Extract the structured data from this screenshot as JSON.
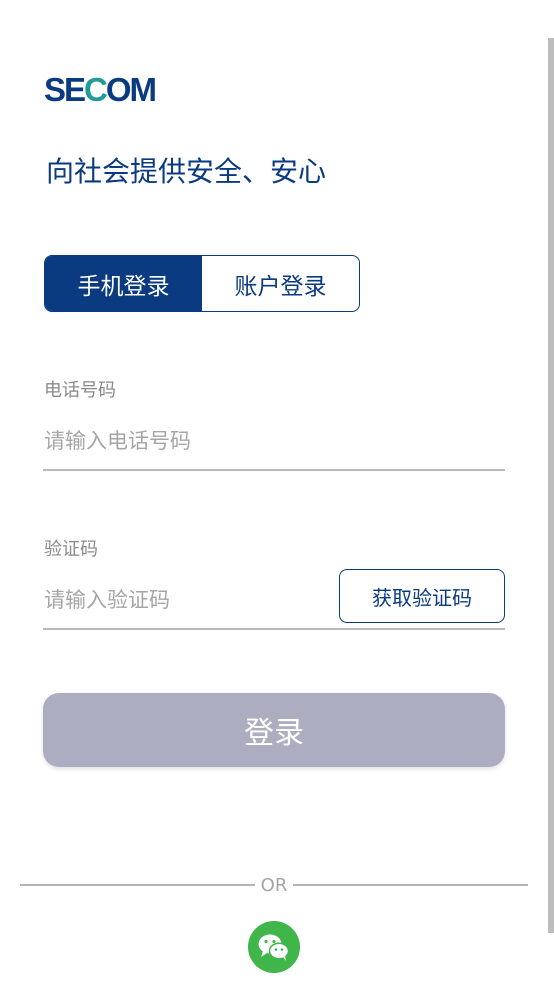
{
  "brand": {
    "logo_text_1": "SE",
    "logo_text_c": "C",
    "logo_text_2": "OM",
    "tagline": "向社会提供安全、安心"
  },
  "login_tabs": {
    "phone": "手机登录",
    "account": "账户登录",
    "active": "phone"
  },
  "phone_field": {
    "label": "电话号码",
    "placeholder": "请输入电话号码",
    "value": ""
  },
  "code_field": {
    "label": "验证码",
    "placeholder": "请输入验证码",
    "value": "",
    "get_code_label": "获取验证码"
  },
  "login_button": "登录",
  "divider_text": "OR",
  "social": {
    "wechat_icon": "wechat-icon"
  },
  "colors": {
    "primary": "#0a3a80",
    "login_disabled": "#adadc2",
    "wechat_green": "#3fb54a"
  }
}
